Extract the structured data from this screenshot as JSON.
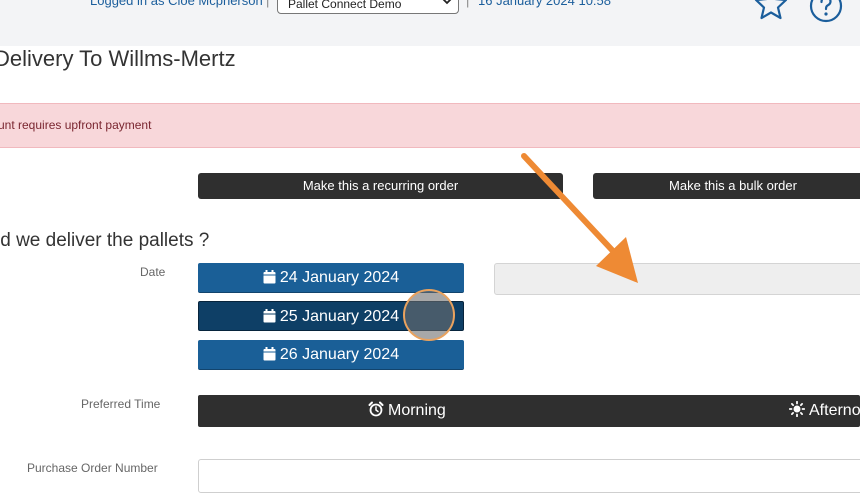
{
  "header": {
    "logged_in_text": "Logged in as Cloe Mcpherson",
    "separator": "|",
    "company_select": {
      "value": "Pallet Connect Demo"
    },
    "datetime": "16 January 2024 10:58",
    "icons": [
      "chevron-down-icon",
      "star-icon",
      "help-icon"
    ]
  },
  "page": {
    "title": "Delivery To Willms-Mertz",
    "alert": "unt requires upfront payment"
  },
  "order_type": {
    "recurring_label": "Make this a recurring order",
    "bulk_label": "Make this a bulk order"
  },
  "delivery": {
    "question": "ld we deliver the pallets ?",
    "date_label": "Date",
    "dates": [
      "24 January 2024",
      "25 January 2024",
      "26 January 2024"
    ],
    "selected_date_index": 1,
    "selected_date_value": "",
    "preferred_time_label": "Preferred Time",
    "times": [
      "Morning",
      "Afterno"
    ],
    "po_label": "Purchase Order Number",
    "po_value": ""
  },
  "annotation": {
    "color": "#ee8a34",
    "marker_color": "#e9a25e"
  },
  "colors": {
    "primary_blue": "#1a5f97",
    "selected_blue": "#0e3f66",
    "dark_button": "#2f2f2f",
    "alert_bg": "#f8d7da"
  }
}
